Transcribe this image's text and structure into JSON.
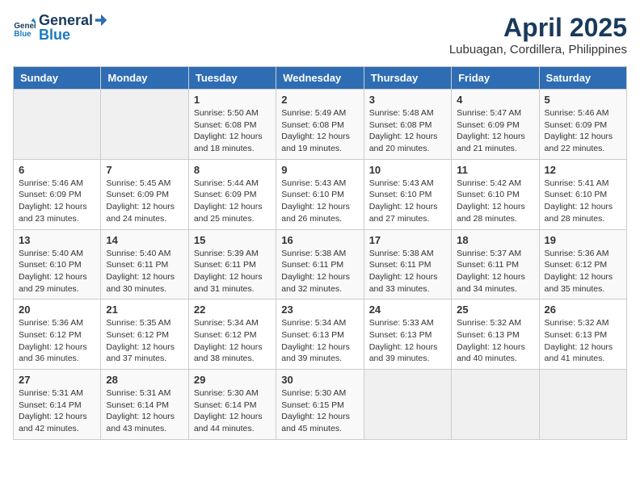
{
  "header": {
    "logo_general": "General",
    "logo_blue": "Blue",
    "title": "April 2025",
    "subtitle": "Lubuagan, Cordillera, Philippines"
  },
  "days_of_week": [
    "Sunday",
    "Monday",
    "Tuesday",
    "Wednesday",
    "Thursday",
    "Friday",
    "Saturday"
  ],
  "weeks": [
    [
      {
        "day": "",
        "sunrise": "",
        "sunset": "",
        "daylight": "",
        "empty": true
      },
      {
        "day": "",
        "sunrise": "",
        "sunset": "",
        "daylight": "",
        "empty": true
      },
      {
        "day": "1",
        "sunrise": "Sunrise: 5:50 AM",
        "sunset": "Sunset: 6:08 PM",
        "daylight": "Daylight: 12 hours and 18 minutes."
      },
      {
        "day": "2",
        "sunrise": "Sunrise: 5:49 AM",
        "sunset": "Sunset: 6:08 PM",
        "daylight": "Daylight: 12 hours and 19 minutes."
      },
      {
        "day": "3",
        "sunrise": "Sunrise: 5:48 AM",
        "sunset": "Sunset: 6:08 PM",
        "daylight": "Daylight: 12 hours and 20 minutes."
      },
      {
        "day": "4",
        "sunrise": "Sunrise: 5:47 AM",
        "sunset": "Sunset: 6:09 PM",
        "daylight": "Daylight: 12 hours and 21 minutes."
      },
      {
        "day": "5",
        "sunrise": "Sunrise: 5:46 AM",
        "sunset": "Sunset: 6:09 PM",
        "daylight": "Daylight: 12 hours and 22 minutes."
      }
    ],
    [
      {
        "day": "6",
        "sunrise": "Sunrise: 5:46 AM",
        "sunset": "Sunset: 6:09 PM",
        "daylight": "Daylight: 12 hours and 23 minutes."
      },
      {
        "day": "7",
        "sunrise": "Sunrise: 5:45 AM",
        "sunset": "Sunset: 6:09 PM",
        "daylight": "Daylight: 12 hours and 24 minutes."
      },
      {
        "day": "8",
        "sunrise": "Sunrise: 5:44 AM",
        "sunset": "Sunset: 6:09 PM",
        "daylight": "Daylight: 12 hours and 25 minutes."
      },
      {
        "day": "9",
        "sunrise": "Sunrise: 5:43 AM",
        "sunset": "Sunset: 6:10 PM",
        "daylight": "Daylight: 12 hours and 26 minutes."
      },
      {
        "day": "10",
        "sunrise": "Sunrise: 5:43 AM",
        "sunset": "Sunset: 6:10 PM",
        "daylight": "Daylight: 12 hours and 27 minutes."
      },
      {
        "day": "11",
        "sunrise": "Sunrise: 5:42 AM",
        "sunset": "Sunset: 6:10 PM",
        "daylight": "Daylight: 12 hours and 28 minutes."
      },
      {
        "day": "12",
        "sunrise": "Sunrise: 5:41 AM",
        "sunset": "Sunset: 6:10 PM",
        "daylight": "Daylight: 12 hours and 28 minutes."
      }
    ],
    [
      {
        "day": "13",
        "sunrise": "Sunrise: 5:40 AM",
        "sunset": "Sunset: 6:10 PM",
        "daylight": "Daylight: 12 hours and 29 minutes."
      },
      {
        "day": "14",
        "sunrise": "Sunrise: 5:40 AM",
        "sunset": "Sunset: 6:11 PM",
        "daylight": "Daylight: 12 hours and 30 minutes."
      },
      {
        "day": "15",
        "sunrise": "Sunrise: 5:39 AM",
        "sunset": "Sunset: 6:11 PM",
        "daylight": "Daylight: 12 hours and 31 minutes."
      },
      {
        "day": "16",
        "sunrise": "Sunrise: 5:38 AM",
        "sunset": "Sunset: 6:11 PM",
        "daylight": "Daylight: 12 hours and 32 minutes."
      },
      {
        "day": "17",
        "sunrise": "Sunrise: 5:38 AM",
        "sunset": "Sunset: 6:11 PM",
        "daylight": "Daylight: 12 hours and 33 minutes."
      },
      {
        "day": "18",
        "sunrise": "Sunrise: 5:37 AM",
        "sunset": "Sunset: 6:11 PM",
        "daylight": "Daylight: 12 hours and 34 minutes."
      },
      {
        "day": "19",
        "sunrise": "Sunrise: 5:36 AM",
        "sunset": "Sunset: 6:12 PM",
        "daylight": "Daylight: 12 hours and 35 minutes."
      }
    ],
    [
      {
        "day": "20",
        "sunrise": "Sunrise: 5:36 AM",
        "sunset": "Sunset: 6:12 PM",
        "daylight": "Daylight: 12 hours and 36 minutes."
      },
      {
        "day": "21",
        "sunrise": "Sunrise: 5:35 AM",
        "sunset": "Sunset: 6:12 PM",
        "daylight": "Daylight: 12 hours and 37 minutes."
      },
      {
        "day": "22",
        "sunrise": "Sunrise: 5:34 AM",
        "sunset": "Sunset: 6:12 PM",
        "daylight": "Daylight: 12 hours and 38 minutes."
      },
      {
        "day": "23",
        "sunrise": "Sunrise: 5:34 AM",
        "sunset": "Sunset: 6:13 PM",
        "daylight": "Daylight: 12 hours and 39 minutes."
      },
      {
        "day": "24",
        "sunrise": "Sunrise: 5:33 AM",
        "sunset": "Sunset: 6:13 PM",
        "daylight": "Daylight: 12 hours and 39 minutes."
      },
      {
        "day": "25",
        "sunrise": "Sunrise: 5:32 AM",
        "sunset": "Sunset: 6:13 PM",
        "daylight": "Daylight: 12 hours and 40 minutes."
      },
      {
        "day": "26",
        "sunrise": "Sunrise: 5:32 AM",
        "sunset": "Sunset: 6:13 PM",
        "daylight": "Daylight: 12 hours and 41 minutes."
      }
    ],
    [
      {
        "day": "27",
        "sunrise": "Sunrise: 5:31 AM",
        "sunset": "Sunset: 6:14 PM",
        "daylight": "Daylight: 12 hours and 42 minutes."
      },
      {
        "day": "28",
        "sunrise": "Sunrise: 5:31 AM",
        "sunset": "Sunset: 6:14 PM",
        "daylight": "Daylight: 12 hours and 43 minutes."
      },
      {
        "day": "29",
        "sunrise": "Sunrise: 5:30 AM",
        "sunset": "Sunset: 6:14 PM",
        "daylight": "Daylight: 12 hours and 44 minutes."
      },
      {
        "day": "30",
        "sunrise": "Sunrise: 5:30 AM",
        "sunset": "Sunset: 6:15 PM",
        "daylight": "Daylight: 12 hours and 45 minutes."
      },
      {
        "day": "",
        "sunrise": "",
        "sunset": "",
        "daylight": "",
        "empty": true
      },
      {
        "day": "",
        "sunrise": "",
        "sunset": "",
        "daylight": "",
        "empty": true
      },
      {
        "day": "",
        "sunrise": "",
        "sunset": "",
        "daylight": "",
        "empty": true
      }
    ]
  ]
}
